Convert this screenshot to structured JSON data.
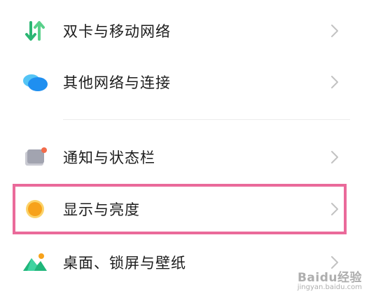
{
  "settings_list": {
    "items": [
      {
        "label": "双卡与移动网络",
        "icon": "dual-sim-arrows-icon",
        "icon_color": "#2bb673"
      },
      {
        "label": "其他网络与连接",
        "icon": "cloud-connection-icon",
        "icon_color": "#2a9df4"
      },
      {
        "label": "通知与状态栏",
        "icon": "notification-card-icon",
        "icon_color": "#9a9ca8",
        "badge_color": "#f26b4a"
      },
      {
        "label": "显示与亮度",
        "icon": "brightness-sun-icon",
        "icon_color": "#f7a21b"
      },
      {
        "label": "桌面、锁屏与壁纸",
        "icon": "wallpaper-mountain-icon",
        "icon_color": "#1fb67a"
      }
    ],
    "highlighted_item": "显示与亮度",
    "highlight_color": "#ea6a9a"
  },
  "watermark": {
    "main": "Baidu经验",
    "sub": "jingyan.baidu.com"
  }
}
